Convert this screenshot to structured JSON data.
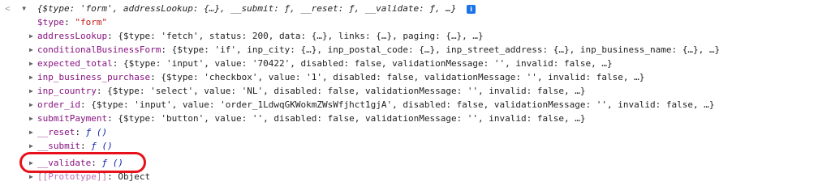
{
  "console": {
    "prompt_icon": "<",
    "summary": "{$type: 'form', addressLookup: {…}, __submit: ƒ, __reset: ƒ, __validate: ƒ, …}",
    "info_badge": "i",
    "type_line": {
      "key": "$type",
      "value": "\"form\""
    },
    "rows": [
      {
        "key": "addressLookup",
        "rest": ": {$type: 'fetch', status: 200, data: {…}, links: {…}, paging: {…}, …}"
      },
      {
        "key": "conditionalBusinessForm",
        "rest": ": {$type: 'if', inp_city: {…}, inp_postal_code: {…}, inp_street_address: {…}, inp_business_name: {…}, …}"
      },
      {
        "key": "expected_total",
        "rest": ": {$type: 'input', value: '70422', disabled: false, validationMessage: '', invalid: false, …}"
      },
      {
        "key": "inp_business_purchase",
        "rest": ": {$type: 'checkbox', value: '1', disabled: false, validationMessage: '', invalid: false, …}"
      },
      {
        "key": "inp_country",
        "rest": ": {$type: 'select', value: 'NL', disabled: false, validationMessage: '', invalid: false, …}"
      },
      {
        "key": "order_id",
        "rest": ": {$type: 'input', value: 'order_1LdwqGKWokmZWsWfjhct1gjA', disabled: false, validationMessage: '', invalid: false, …}"
      },
      {
        "key": "submitPayment",
        "rest": ": {$type: 'button', value: '', disabled: false, validationMessage: '', invalid: false, …}"
      }
    ],
    "fn_rows": [
      {
        "key": "__reset",
        "value": "ƒ ()"
      },
      {
        "key": "__submit",
        "value": "ƒ ()"
      },
      {
        "key": "__validate",
        "value": "ƒ ()"
      }
    ],
    "prototype": {
      "key": "[[Prototype]]",
      "value": "Object"
    }
  },
  "colors": {
    "highlight": "#e8111b",
    "property_key": "#881280",
    "string": "#c41a16",
    "info_badge": "#1a73e8"
  }
}
